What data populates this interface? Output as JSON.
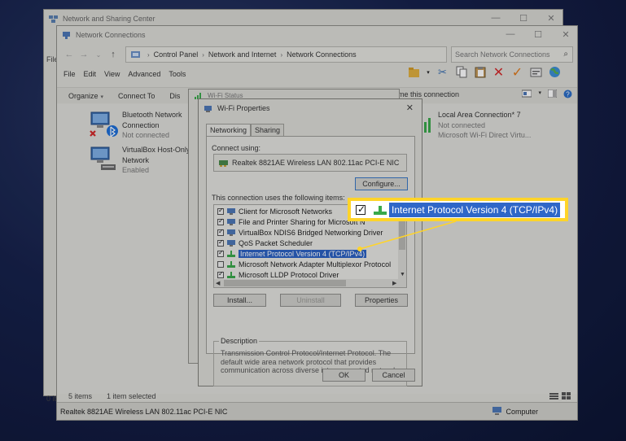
{
  "colors": {
    "accent_yellow": "#ffd42a",
    "selection_blue": "#2f67c8",
    "error_red": "#d42a2a",
    "desktop": "#16214a"
  },
  "nsc_window": {
    "title": "Network and Sharing Center",
    "side_label": "File",
    "status_label": "0 ite"
  },
  "nc_window": {
    "title": "Network Connections",
    "breadcrumb": [
      "Control Panel",
      "Network and Internet",
      "Network Connections"
    ],
    "search_placeholder": "Search Network Connections",
    "menu": [
      "File",
      "Edit",
      "View",
      "Advanced",
      "Tools"
    ],
    "toolbar_icons": [
      "folder-icon",
      "cut-icon",
      "copy-icon",
      "paste-icon",
      "delete-icon",
      "checkmark-icon",
      "properties-icon",
      "globe-icon"
    ],
    "commands": {
      "organize": "Organize",
      "connect_to": "Connect To",
      "disable": "Dis",
      "rename": "ame this connection"
    },
    "items": [
      {
        "name": "Bluetooth Network",
        "name2": "Connection",
        "status": "Not connected",
        "icon": "bluetooth-network-icon"
      },
      {
        "name": "VirtualBox Host-Only",
        "name2": "Network",
        "status": "Enabled",
        "icon": "ethernet-network-icon"
      },
      {
        "name": "Local Area Connection* 7",
        "status": "Not connected",
        "device": "Microsoft Wi-Fi Direct Virtu...",
        "icon": "wifi-network-icon"
      }
    ],
    "status_count": "5 items",
    "status_selected": "1 item selected",
    "footer_left": "Realtek 8821AE Wireless LAN 802.11ac PCI-E NIC",
    "footer_right": "Computer"
  },
  "status_window": {
    "title": "Wi-Fi Status"
  },
  "dialog": {
    "title": "Wi-Fi Properties",
    "tabs": [
      "Networking",
      "Sharing"
    ],
    "connect_using_label": "Connect using:",
    "adapter": "Realtek 8821AE Wireless LAN 802.11ac PCI-E NIC",
    "configure_button": "Configure...",
    "uses_label": "This connection uses the following items:",
    "items": [
      {
        "label": "Client for Microsoft Networks",
        "checked": true
      },
      {
        "label": "File and Printer Sharing for Microsoft N",
        "checked": true
      },
      {
        "label": "VirtualBox NDIS6 Bridged Networking Driver",
        "checked": true
      },
      {
        "label": "QoS Packet Scheduler",
        "checked": true
      },
      {
        "label": "Internet Protocol Version 4 (TCP/IPv4)",
        "checked": true,
        "selected": true
      },
      {
        "label": "Microsoft Network Adapter Multiplexor Protocol",
        "checked": false
      },
      {
        "label": "Microsoft LLDP Protocol Driver",
        "checked": true
      }
    ],
    "install_button": "Install...",
    "uninstall_button": "Uninstall",
    "properties_button": "Properties",
    "description_title": "Description",
    "description_text": "Transmission Control Protocol/Internet Protocol. The default wide area network protocol that provides communication across diverse interconnected networks.",
    "ok_button": "OK",
    "cancel_button": "Cancel"
  },
  "callout": {
    "text": "Internet Protocol Version 4 (TCP/IPv4)",
    "checked": true
  }
}
